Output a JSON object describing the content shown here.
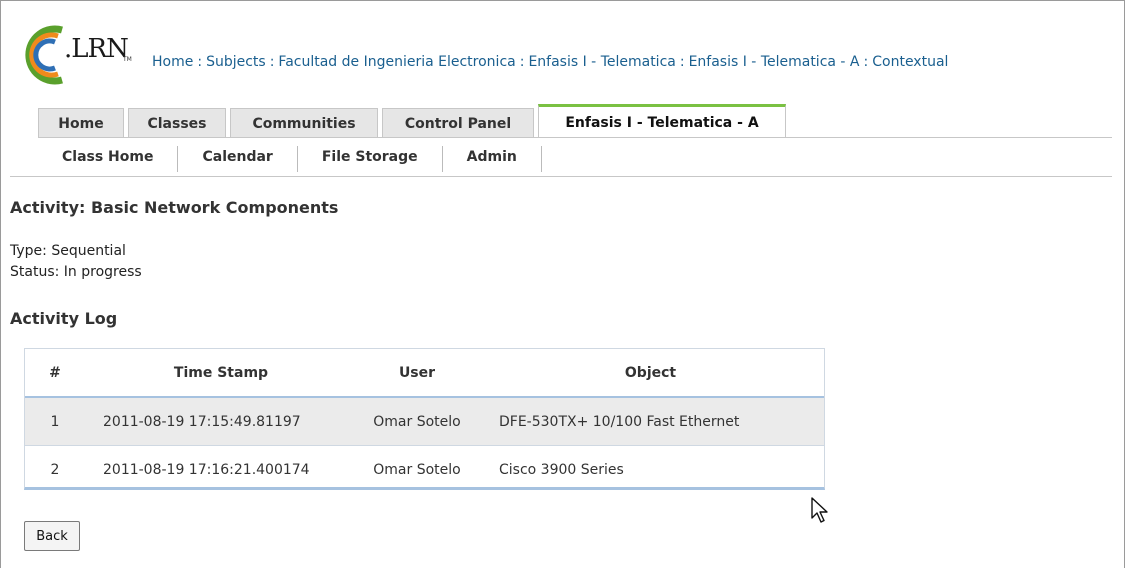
{
  "header": {
    "logo_text": ".LRN",
    "logo_tm": "TM",
    "breadcrumb": [
      "Home",
      "Subjects",
      "Facultad de Ingenieria Electronica",
      "Enfasis I - Telematica",
      "Enfasis I - Telematica - A",
      "Contextual"
    ],
    "breadcrumb_separator": ":"
  },
  "tabs": [
    {
      "label": "Home",
      "active": false
    },
    {
      "label": "Classes",
      "active": false
    },
    {
      "label": "Communities",
      "active": false
    },
    {
      "label": "Control Panel",
      "active": false
    },
    {
      "label": "Enfasis I - Telematica - A",
      "active": true
    }
  ],
  "subnav": [
    "Class Home",
    "Calendar",
    "File Storage",
    "Admin"
  ],
  "activity": {
    "title": "Activity: Basic Network Components",
    "type": "Type: Sequential",
    "status": "Status: In progress"
  },
  "log": {
    "title": "Activity Log",
    "columns": [
      "#",
      "Time Stamp",
      "User",
      "Object"
    ],
    "rows": [
      [
        "1",
        "2011-08-19 17:15:49.81197",
        "Omar Sotelo",
        "DFE-530TX+ 10/100 Fast Ethernet"
      ],
      [
        "2",
        "2011-08-19 17:16:21.400174",
        "Omar Sotelo",
        "Cisco 3900 Series"
      ]
    ]
  },
  "buttons": {
    "back": "Back"
  },
  "colors": {
    "link": "#1a5f8f",
    "active_tab_accent": "#7ac142",
    "table_accent": "#a6c2e0",
    "odd_row": "#ebebeb"
  }
}
